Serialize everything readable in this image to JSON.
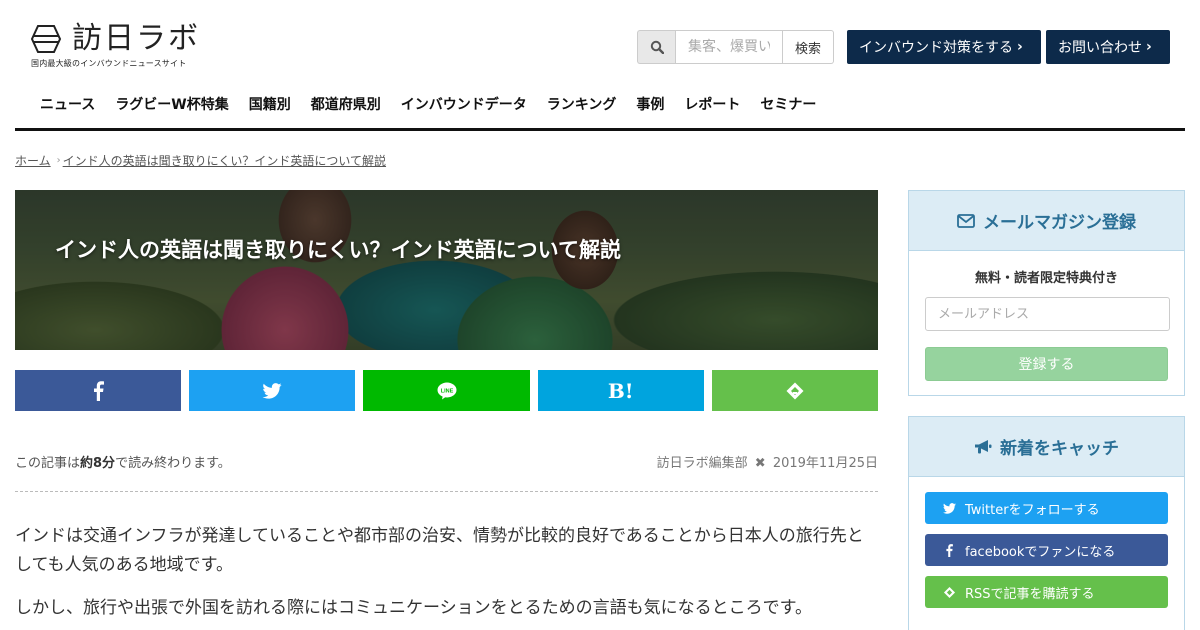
{
  "brand": {
    "name": "訪日ラボ",
    "tagline": "国内最大級のインバウンドニュースサイト"
  },
  "search": {
    "placeholder": "集客、爆買い",
    "submit_label": "検索"
  },
  "header_ctas": {
    "inbound_label": "インバウンド対策をする",
    "contact_label": "お問い合わせ"
  },
  "nav": {
    "items": [
      "ニュース",
      "ラグビーW杯特集",
      "国籍別",
      "都道府県別",
      "インバウンドデータ",
      "ランキング",
      "事例",
      "レポート",
      "セミナー"
    ]
  },
  "breadcrumb": {
    "home": "ホーム",
    "current": "インド人の英語は聞き取りにくい？インド英語について解説"
  },
  "article": {
    "title": "インド人の英語は聞き取りにくい？インド英語について解説",
    "read_prefix": "この記事は",
    "read_time": "約8分",
    "read_suffix": "で読み終わります。",
    "author": "訪日ラボ編集部",
    "date": "2019年11月25日",
    "paragraphs": [
      "インドは交通インフラが発達していることや都市部の治安、情勢が比較的良好であることから日本人の旅行先としても人気のある地域です。",
      "しかし、旅行や出張で外国を訪れる際にはコミュニケーションをとるための言語も気になるところです。"
    ]
  },
  "share": {
    "hatena_label": "B!"
  },
  "newsletter": {
    "title": "メールマガジン登録",
    "subtitle": "無料・読者限定特典付き",
    "email_placeholder": "メールアドレス",
    "submit_label": "登録する"
  },
  "follow": {
    "title": "新着をキャッチ",
    "twitter_label": "Twitterをフォローする",
    "facebook_label": "facebookでファンになる",
    "rss_label": "RSSで記事を購読する"
  },
  "colors": {
    "navy": "#0d2a4a",
    "facebook": "#3b5998",
    "twitter": "#1da1f2",
    "line": "#00b900",
    "hatena": "#00a4de",
    "feedly": "#65c04b",
    "widget_head": "#dcecf5",
    "widget_title": "#2a6f96"
  },
  "icons": {
    "logo": "hexagon-logo-icon",
    "search": "magnifier-icon",
    "mail": "envelope-icon",
    "megaphone": "bullhorn-icon"
  }
}
